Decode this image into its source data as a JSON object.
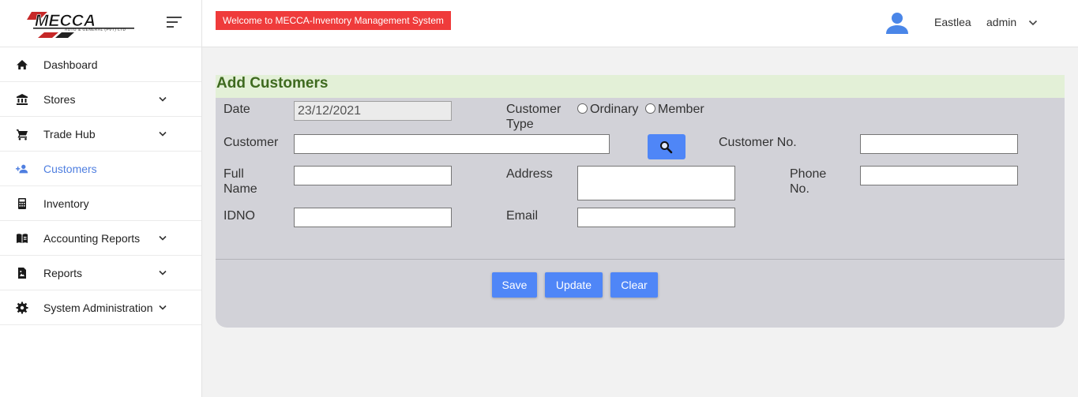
{
  "brand": {
    "logo_text": "MECCA",
    "logo_subtext": "AUTO & GENERAL (PVT) LTD"
  },
  "header": {
    "welcome": "Welcome to MECCA-Inventory Management System",
    "branch": "Eastlea",
    "user": "admin"
  },
  "sidebar": {
    "items": [
      {
        "label": "Dashboard",
        "icon": "home-icon",
        "has_submenu": false
      },
      {
        "label": "Stores",
        "icon": "bank-icon",
        "has_submenu": true
      },
      {
        "label": "Trade Hub",
        "icon": "cart-icon",
        "has_submenu": true
      },
      {
        "label": "Customers",
        "icon": "add-person-icon",
        "has_submenu": false,
        "active": true
      },
      {
        "label": "Inventory",
        "icon": "calculator-icon",
        "has_submenu": false
      },
      {
        "label": "Accounting Reports",
        "icon": "book-icon",
        "has_submenu": true
      },
      {
        "label": "Reports",
        "icon": "file-icon",
        "has_submenu": true
      },
      {
        "label": "System Administration",
        "icon": "gear-icon",
        "has_submenu": true
      }
    ]
  },
  "form": {
    "title": "Add Customers",
    "date": {
      "label": "Date",
      "value": "23/12/2021"
    },
    "customer_type": {
      "label_line1": "Customer",
      "label_line2": "Type",
      "options": [
        "Ordinary",
        "Member"
      ]
    },
    "customer": {
      "label": "Customer",
      "value": ""
    },
    "customer_no": {
      "label": "Customer No.",
      "value": ""
    },
    "full_name": {
      "label_line1": "Full",
      "label_line2": "Name",
      "value": ""
    },
    "address": {
      "label": "Address",
      "value": ""
    },
    "phone_no": {
      "label_line1": "Phone",
      "label_line2": "No.",
      "value": ""
    },
    "idno": {
      "label": "IDNO",
      "value": ""
    },
    "email": {
      "label": "Email",
      "value": ""
    },
    "buttons": {
      "save": "Save",
      "update": "Update",
      "clear": "Clear"
    }
  },
  "colors": {
    "accent": "#4f86f7",
    "welcome_bg": "#ef3b3b",
    "title_green": "#3e6a1f",
    "title_bg": "#e3f0d7",
    "panel_bg": "#d2d2d8",
    "active_nav": "#4f7fe0"
  }
}
